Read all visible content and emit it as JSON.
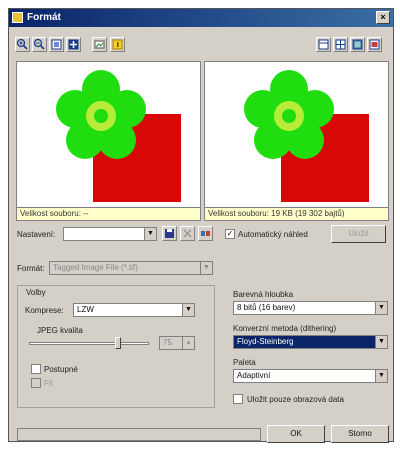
{
  "window": {
    "title": "Formát",
    "close_glyph": "×"
  },
  "toolbar": {
    "left_icons": [
      "zoom-in-icon",
      "zoom-out-icon",
      "fit-icon",
      "actual-size-icon",
      "image-icon",
      "info-icon"
    ],
    "right_icons": [
      "view-single-icon",
      "view-split-icon",
      "view-side-icon",
      "view-full-icon"
    ]
  },
  "preview": {
    "left_size_text": "Velikost souboru: --",
    "right_size_text": "Velikost souboru: 19 KB (19 302 bajtů)"
  },
  "settings": {
    "label": "Nastavení:",
    "value": "",
    "auto_check_label": "Automatický náhled",
    "auto_checked": true,
    "apply_button": "Uložit"
  },
  "format": {
    "label": "Formát:",
    "value": "Tagged Image File (*.tif)"
  },
  "options": {
    "group_label": "Volby",
    "compression_label": "Komprese:",
    "compression_value": "LZW",
    "quality_label": "JPEG kvalita",
    "quality_value": "75",
    "quality_fraction": 0.75,
    "progressive_label": "Postupné",
    "progressive_checked": false,
    "disabled_label": "Fit",
    "disabled_checked": false
  },
  "color_depth": {
    "label": "Barevná hloubka",
    "value": "8 bitů (16 barev)"
  },
  "conversion": {
    "label": "Konverzní metoda (dithering)",
    "value": "Floyd-Steinberg"
  },
  "palette": {
    "label": "Paleta",
    "value": "Adaptivní"
  },
  "save_original_label": "Uložit pouze obrazová data",
  "save_original_checked": false,
  "buttons": {
    "ok": "OK",
    "cancel": "Storno"
  },
  "colors": {
    "title_bar": "#0a246a",
    "flower_green": "#20dd10",
    "flower_center": "#b8ec3a",
    "red_block": "#d80808",
    "dialog_face": "#d4d0c8",
    "selection": "#0a246a"
  }
}
